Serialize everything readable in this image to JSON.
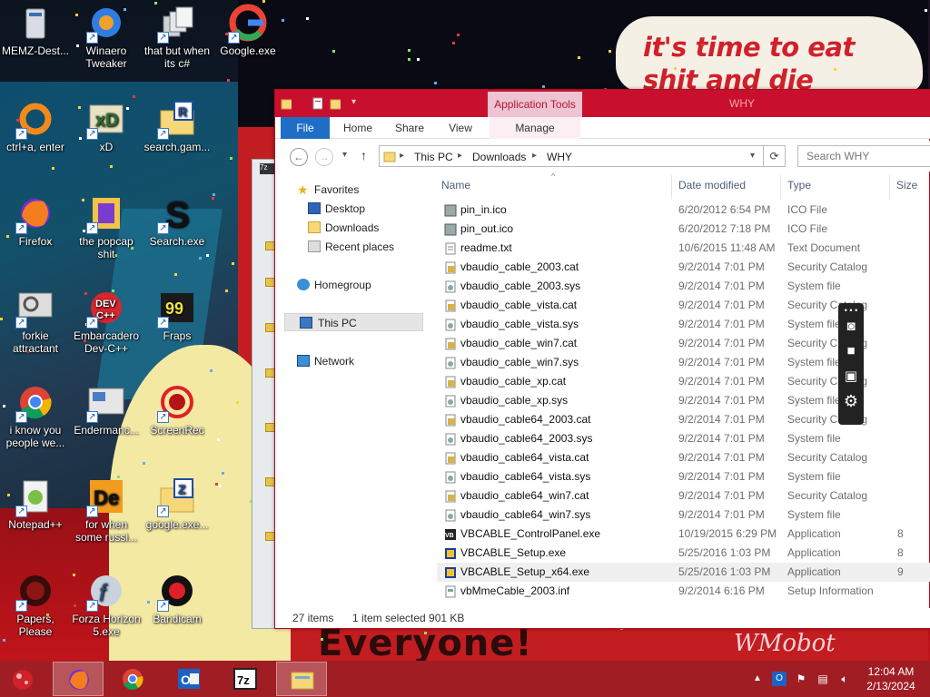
{
  "wallpaper": {
    "bubble_text": "it's time to eat shit and die andcelebrate",
    "bottom_text": "Everyone!",
    "bottom_right_text": "WMobot"
  },
  "desktop": {
    "icons": [
      {
        "label": "MEMZ-Dest...",
        "icon": "recycle-bin-icon"
      },
      {
        "label": "Winaero Tweaker",
        "icon": "winaero-tweaker-icon"
      },
      {
        "label": "that but when its c#",
        "icon": "windows-stack-icon"
      },
      {
        "label": "Google.exe",
        "icon": "google-icon"
      },
      {
        "label": "ctrl+a, enter",
        "icon": "orange-ring-icon"
      },
      {
        "label": "xD",
        "icon": "xd-icon"
      },
      {
        "label": "search.gam...",
        "icon": "folder-r-icon"
      },
      {
        "label": "Firefox",
        "icon": "firefox-icon"
      },
      {
        "label": "the popcap shit",
        "icon": "popcap-icon"
      },
      {
        "label": "Search.exe",
        "icon": "search-exe-icon"
      },
      {
        "label": "forkie attractant",
        "icon": "gear-monitor-icon"
      },
      {
        "label": "Embarcadero Dev-C++",
        "icon": "devcpp-icon"
      },
      {
        "label": "Fraps",
        "icon": "fraps-icon"
      },
      {
        "label": "i know you people we...",
        "icon": "chrome-icon"
      },
      {
        "label": "Endermanc...",
        "icon": "endermanch-icon"
      },
      {
        "label": "ScreenRec",
        "icon": "screenrec-icon"
      },
      {
        "label": "Notepad++",
        "icon": "notepadpp-icon"
      },
      {
        "label": "for when some russi...",
        "icon": "de-icon"
      },
      {
        "label": "google.exe...",
        "icon": "folder-z-icon"
      },
      {
        "label": "Papers, Please",
        "icon": "papers-please-icon"
      },
      {
        "label": "Forza Horizon 5.exe",
        "icon": "flash-icon"
      },
      {
        "label": "Bandicam",
        "icon": "bandicam-icon"
      }
    ]
  },
  "explorer": {
    "title": "WHY",
    "contextual_tab": "Application Tools",
    "tabs": {
      "file": "File",
      "home": "Home",
      "share": "Share",
      "view": "View",
      "manage": "Manage"
    },
    "breadcrumb": [
      "This PC",
      "Downloads",
      "WHY"
    ],
    "search_placeholder": "Search WHY",
    "nav": {
      "favorites": "Favorites",
      "desktop": "Desktop",
      "downloads": "Downloads",
      "recent": "Recent places",
      "homegroup": "Homegroup",
      "thispc": "This PC",
      "network": "Network"
    },
    "columns": {
      "name": "Name",
      "date": "Date modified",
      "type": "Type",
      "size": "Size"
    },
    "files": [
      {
        "name": "pin_in.ico",
        "date": "6/20/2012 6:54 PM",
        "type": "ICO File",
        "size": "",
        "icon": "ico-file-icon"
      },
      {
        "name": "pin_out.ico",
        "date": "6/20/2012 7:18 PM",
        "type": "ICO File",
        "size": "",
        "icon": "ico-file-icon"
      },
      {
        "name": "readme.txt",
        "date": "10/6/2015 11:48 AM",
        "type": "Text Document",
        "size": "",
        "icon": "text-file-icon"
      },
      {
        "name": "vbaudio_cable_2003.cat",
        "date": "9/2/2014 7:01 PM",
        "type": "Security Catalog",
        "size": "",
        "icon": "catalog-file-icon"
      },
      {
        "name": "vbaudio_cable_2003.sys",
        "date": "9/2/2014 7:01 PM",
        "type": "System file",
        "size": "",
        "icon": "system-file-icon"
      },
      {
        "name": "vbaudio_cable_vista.cat",
        "date": "9/2/2014 7:01 PM",
        "type": "Security Catalog",
        "size": "",
        "icon": "catalog-file-icon"
      },
      {
        "name": "vbaudio_cable_vista.sys",
        "date": "9/2/2014 7:01 PM",
        "type": "System file",
        "size": "",
        "icon": "system-file-icon"
      },
      {
        "name": "vbaudio_cable_win7.cat",
        "date": "9/2/2014 7:01 PM",
        "type": "Security Catalog",
        "size": "",
        "icon": "catalog-file-icon"
      },
      {
        "name": "vbaudio_cable_win7.sys",
        "date": "9/2/2014 7:01 PM",
        "type": "System file",
        "size": "",
        "icon": "system-file-icon"
      },
      {
        "name": "vbaudio_cable_xp.cat",
        "date": "9/2/2014 7:01 PM",
        "type": "Security Catalog",
        "size": "",
        "icon": "catalog-file-icon"
      },
      {
        "name": "vbaudio_cable_xp.sys",
        "date": "9/2/2014 7:01 PM",
        "type": "System file",
        "size": "",
        "icon": "system-file-icon"
      },
      {
        "name": "vbaudio_cable64_2003.cat",
        "date": "9/2/2014 7:01 PM",
        "type": "Security Catalog",
        "size": "",
        "icon": "catalog-file-icon"
      },
      {
        "name": "vbaudio_cable64_2003.sys",
        "date": "9/2/2014 7:01 PM",
        "type": "System file",
        "size": "",
        "icon": "system-file-icon"
      },
      {
        "name": "vbaudio_cable64_vista.cat",
        "date": "9/2/2014 7:01 PM",
        "type": "Security Catalog",
        "size": "",
        "icon": "catalog-file-icon"
      },
      {
        "name": "vbaudio_cable64_vista.sys",
        "date": "9/2/2014 7:01 PM",
        "type": "System file",
        "size": "",
        "icon": "system-file-icon"
      },
      {
        "name": "vbaudio_cable64_win7.cat",
        "date": "9/2/2014 7:01 PM",
        "type": "Security Catalog",
        "size": "",
        "icon": "catalog-file-icon"
      },
      {
        "name": "vbaudio_cable64_win7.sys",
        "date": "9/2/2014 7:01 PM",
        "type": "System file",
        "size": "",
        "icon": "system-file-icon"
      },
      {
        "name": "VBCABLE_ControlPanel.exe",
        "date": "10/19/2015 6:29 PM",
        "type": "Application",
        "size": "8",
        "icon": "vb-app-icon"
      },
      {
        "name": "VBCABLE_Setup.exe",
        "date": "5/25/2016 1:03 PM",
        "type": "Application",
        "size": "8",
        "icon": "setup-app-icon"
      },
      {
        "name": "VBCABLE_Setup_x64.exe",
        "date": "5/25/2016 1:03 PM",
        "type": "Application",
        "size": "9",
        "icon": "setup-app-icon",
        "selected": true
      },
      {
        "name": "vbMmeCable_2003.inf",
        "date": "9/2/2014 6:16 PM",
        "type": "Setup Information",
        "size": "",
        "icon": "inf-file-icon"
      }
    ],
    "status": {
      "count": "27 items",
      "selection": "1 item selected  901 KB"
    }
  },
  "taskbar": {
    "apps": [
      {
        "name": "firefox",
        "icon": "firefox-icon",
        "active": true
      },
      {
        "name": "chrome",
        "icon": "chrome-icon",
        "active": false
      },
      {
        "name": "outlook",
        "icon": "outlook-icon",
        "active": false
      },
      {
        "name": "7zip",
        "icon": "seven-zip-icon",
        "active": false
      },
      {
        "name": "file-explorer",
        "icon": "file-explorer-icon",
        "active": true
      }
    ],
    "clock": {
      "time": "12:04 AM",
      "date": "2/13/2024"
    }
  },
  "colors": {
    "titlebar": "#c8102e",
    "taskbar": "#a01d24",
    "file_tab": "#1f6ec6",
    "accent_text": "#4c607a"
  }
}
